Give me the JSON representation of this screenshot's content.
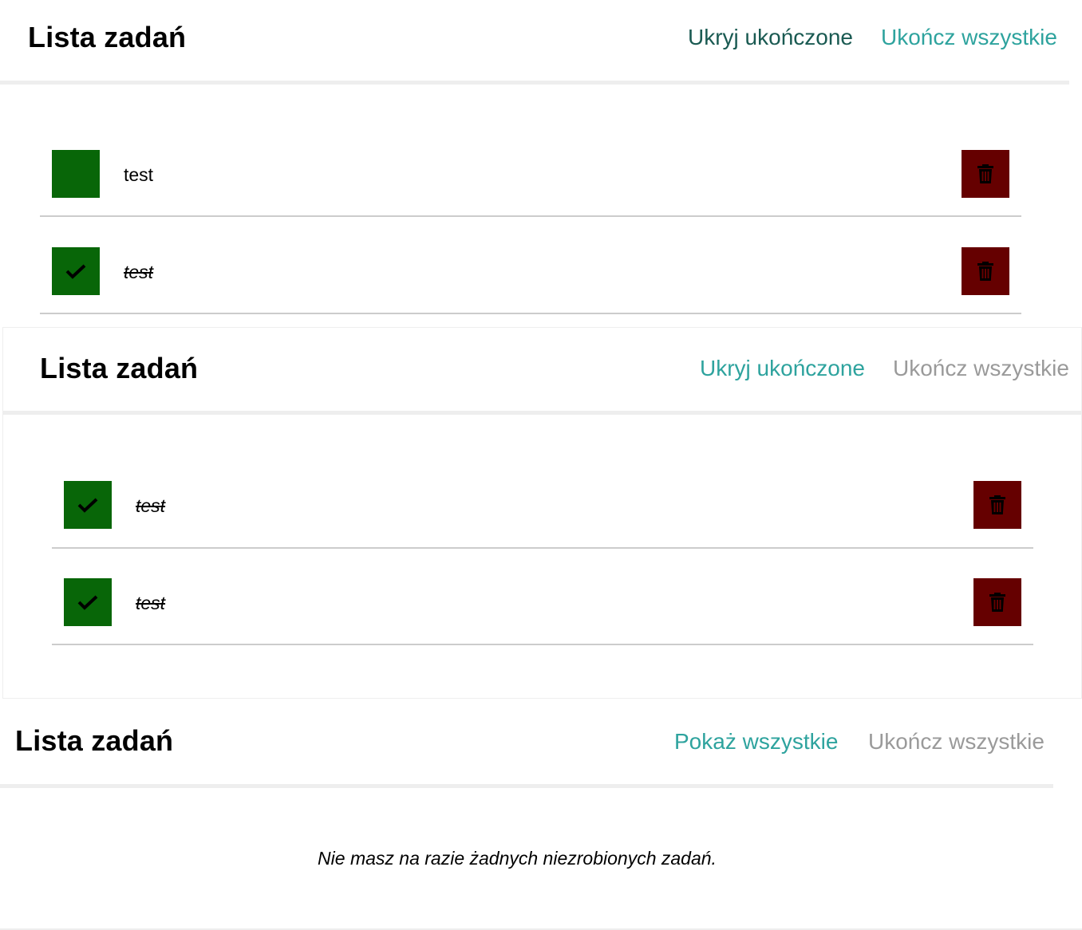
{
  "panels": [
    {
      "title": "Lista zadań",
      "toggle_label": "Ukryj ukończone",
      "complete_all_label": "Ukończ wszystkie",
      "tasks": [
        {
          "text": "test",
          "done": false
        },
        {
          "text": "test",
          "done": true
        }
      ]
    },
    {
      "title": "Lista zadań",
      "toggle_label": "Ukryj ukończone",
      "complete_all_label": "Ukończ wszystkie",
      "tasks": [
        {
          "text": "test",
          "done": true
        },
        {
          "text": "test",
          "done": true
        }
      ]
    },
    {
      "title": "Lista zadań",
      "toggle_label": "Pokaż wszystkie",
      "complete_all_label": "Ukończ wszystkie",
      "empty_message": "Nie masz na razie żadnych niezrobionych zadań."
    }
  ],
  "icons": {
    "check": "check-icon",
    "delete": "trash-icon"
  },
  "colors": {
    "check_bg": "#086608",
    "delete_bg": "#650000",
    "link_teal": "#2ea39e",
    "link_dark": "#1a5a52",
    "link_disabled": "#9a9a9a"
  }
}
